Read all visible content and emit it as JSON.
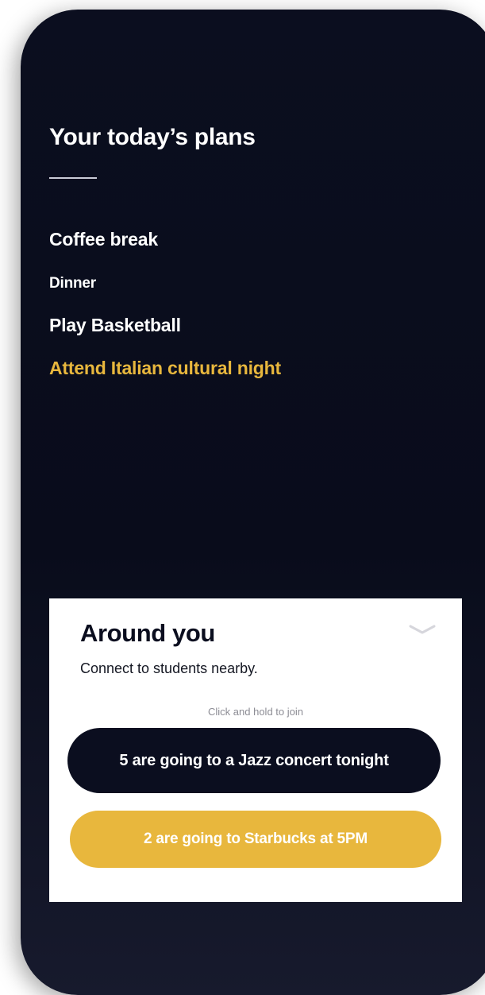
{
  "plans": {
    "title": "Your today’s plans",
    "items": [
      {
        "label": "Coffee break"
      },
      {
        "label": "Dinner"
      },
      {
        "label": "Play Basketball"
      },
      {
        "label": "Attend Italian cultural night",
        "highlight": true
      }
    ]
  },
  "around": {
    "title": "Around you",
    "subtitle": "Connect to students nearby.",
    "hint": "Click and hold to join",
    "toggle_icon": "chevron-down-icon",
    "events": [
      {
        "label": "5 are going to a Jazz concert tonight",
        "style": "dark"
      },
      {
        "label": "2 are going to Starbucks at 5PM",
        "style": "gold"
      }
    ]
  },
  "colors": {
    "background": "#0b0e1f",
    "accent": "#e8b73d",
    "card": "#ffffff"
  }
}
